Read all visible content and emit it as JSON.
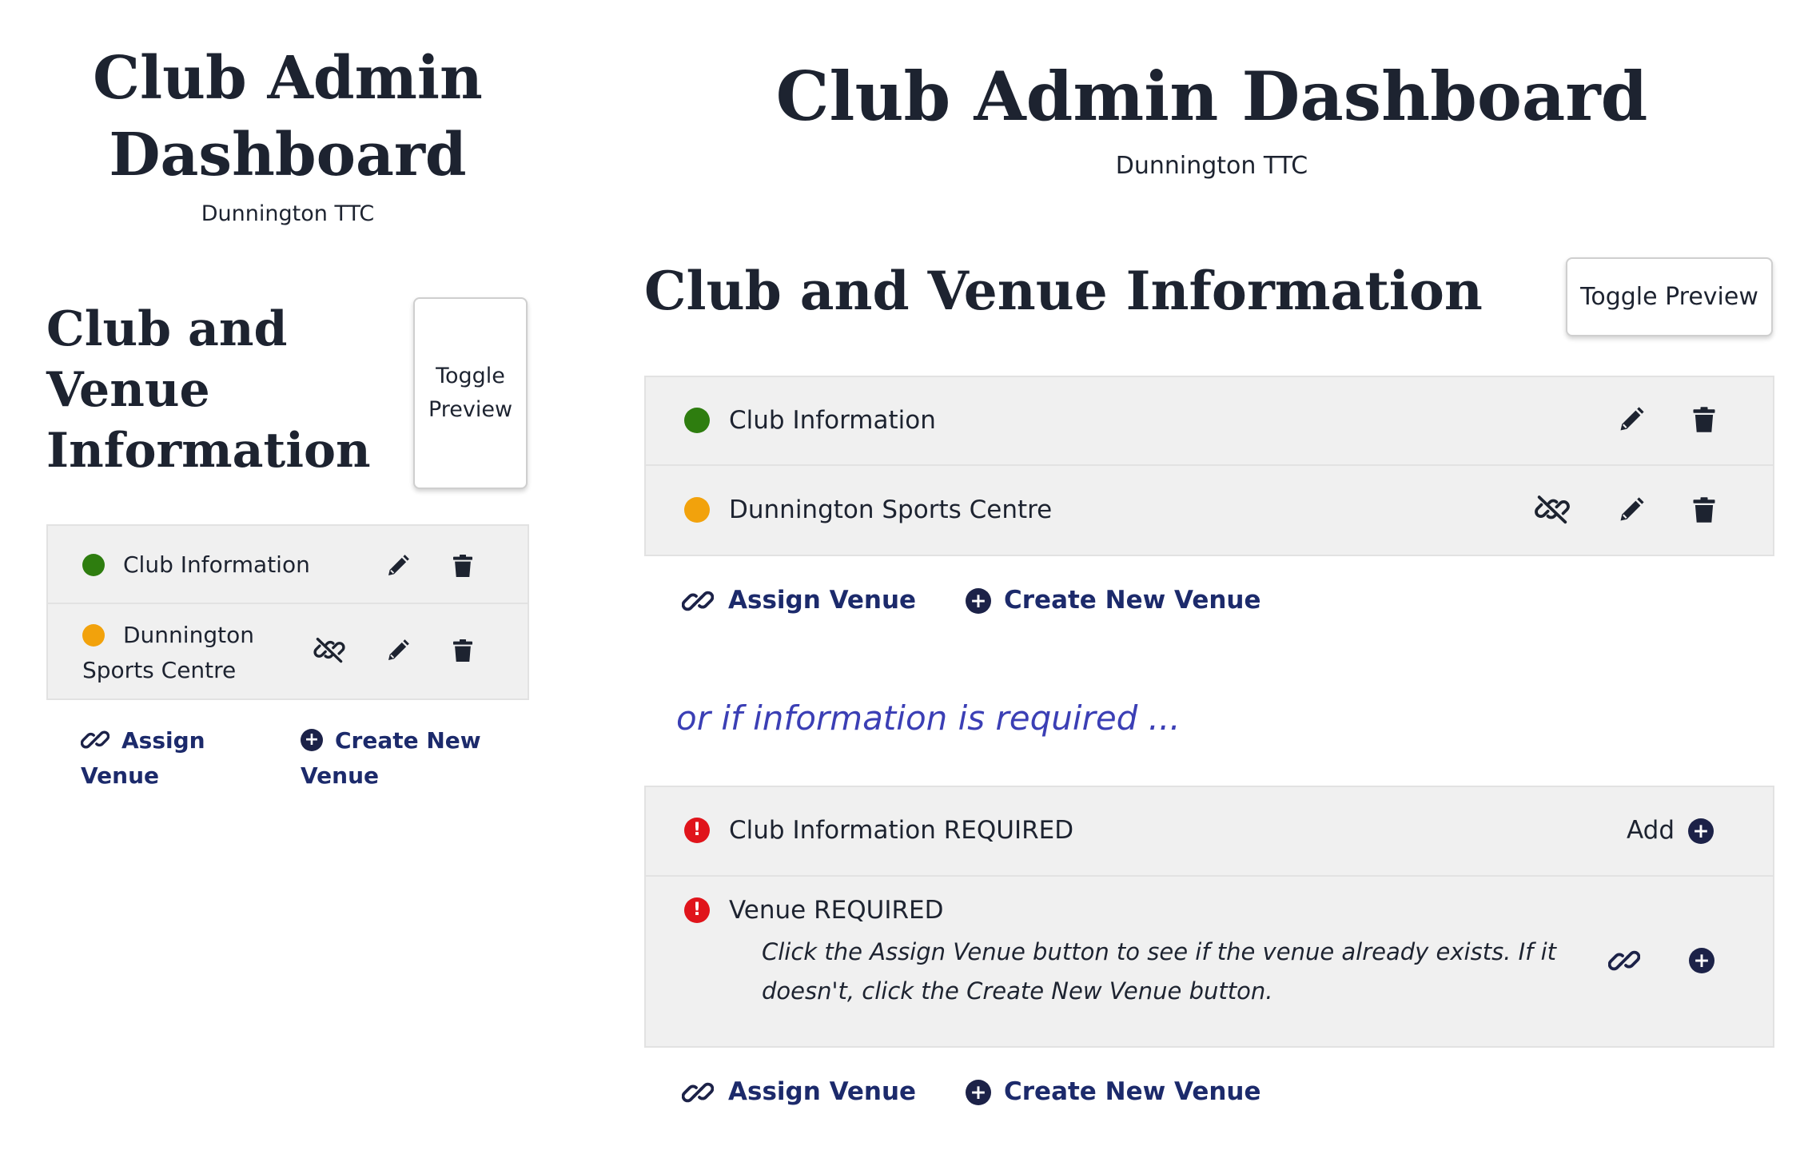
{
  "colors": {
    "status_ok": "#2e7d0f",
    "status_partial": "#f2a20c",
    "status_required": "#e0141b",
    "accent": "#1c2a6b",
    "note": "#3b3fb5"
  },
  "mobile": {
    "title_line1": "Club Admin",
    "title_line2": "Dashboard",
    "club_name": "Dunnington TTC",
    "section_line1": "Club and",
    "section_line2": "Venue",
    "section_line3": "Information",
    "toggle_line1": "Toggle",
    "toggle_line2": "Preview",
    "items": [
      {
        "label": "Club Information",
        "status": "green"
      },
      {
        "label_line1": "Dunnington",
        "label_line2": "Sports Centre",
        "status": "orange"
      }
    ],
    "assign_line1": "Assign",
    "assign_line2": "Venue",
    "create_line1": "Create New",
    "create_line2": "Venue"
  },
  "desktop": {
    "title": "Club Admin Dashboard",
    "club_name": "Dunnington TTC",
    "section_title": "Club and Venue Information",
    "toggle_label": "Toggle Preview",
    "items": [
      {
        "label": "Club Information",
        "status": "green"
      },
      {
        "label": "Dunnington Sports Centre",
        "status": "orange"
      }
    ],
    "assign_label": "Assign Venue",
    "create_label": "Create New Venue",
    "note": "or if information is required ...",
    "required_items": [
      {
        "label_main": "Club Information",
        "label_suffix": " REQUIRED",
        "add_label": "Add"
      },
      {
        "label_main": "Venue",
        "label_suffix": " REQUIRED",
        "help_line1": "Click the Assign Venue button to see if the venue already exists. If it",
        "help_line2": "doesn't, click the Create New Venue button."
      }
    ],
    "assign_label_2": "Assign Venue",
    "create_label_2": "Create New Venue"
  }
}
